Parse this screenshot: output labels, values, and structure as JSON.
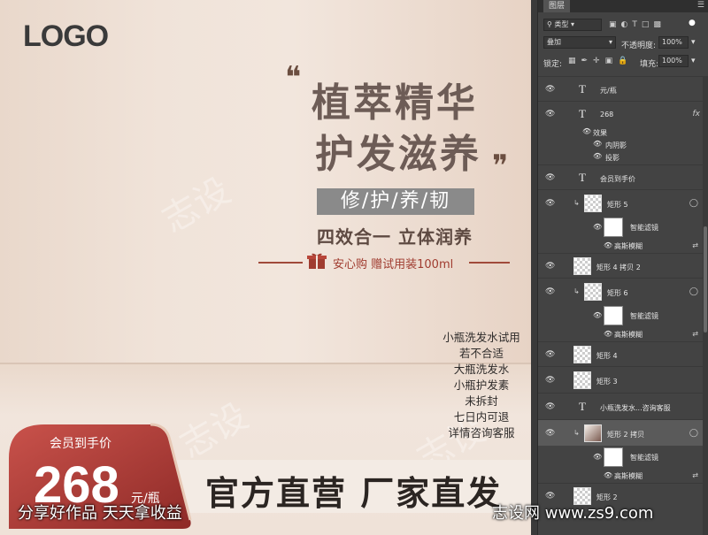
{
  "canvas": {
    "logo": "LOGO",
    "headline_1": "植萃精华",
    "headline_2": "护发滋养",
    "tag": "修/护/养/韧",
    "subline": "四效合一 立体润养",
    "gift_text": "安心购 赠试用装100ml",
    "notes": [
      "小瓶洗发水试用",
      "若不合适",
      "大瓶洗发水",
      "小瓶护发素",
      "未拆封",
      "七日内可退",
      "详情咨询客服"
    ],
    "member_label": "会员到手价",
    "price": "268",
    "price_unit": "元/瓶",
    "official": "官方直营 厂家直发",
    "watermarks": [
      "志设",
      "志设",
      "志设"
    ]
  },
  "overlay": {
    "left": "分享好作品 天天拿收益",
    "right": "志设网 www.zs9.com"
  },
  "panel": {
    "tab": "图层",
    "kind_label": "类型",
    "blend_mode": "叠加",
    "opacity_label": "不透明度:",
    "opacity_value": "100%",
    "lock_label": "锁定:",
    "fill_label": "填充:",
    "fill_value": "100%",
    "layers": [
      {
        "name": "元/瓶",
        "type": "text"
      },
      {
        "name": "268",
        "type": "text",
        "fx": "fx"
      },
      {
        "name": "效果",
        "type": "effect"
      },
      {
        "name": "内阴影",
        "type": "effect"
      },
      {
        "name": "投影",
        "type": "effect"
      },
      {
        "name": "会员到手价",
        "type": "text"
      },
      {
        "name": "矩形 5",
        "type": "shape"
      },
      {
        "name": "智能滤镜",
        "type": "filter"
      },
      {
        "name": "高斯模糊",
        "type": "filter"
      },
      {
        "name": "矩形 4 拷贝 2",
        "type": "shape"
      },
      {
        "name": "矩形 6",
        "type": "shape"
      },
      {
        "name": "智能滤镜",
        "type": "filter"
      },
      {
        "name": "高斯模糊",
        "type": "filter"
      },
      {
        "name": "矩形 4",
        "type": "shape"
      },
      {
        "name": "矩形 3",
        "type": "shape"
      },
      {
        "name": "小瓶洗发水...咨询客服",
        "type": "text"
      },
      {
        "name": "矩形 2 拷贝",
        "type": "shape"
      },
      {
        "name": "智能滤镜",
        "type": "filter"
      },
      {
        "name": "高斯模糊",
        "type": "filter"
      },
      {
        "name": "矩形 2",
        "type": "shape"
      }
    ]
  },
  "colors": {
    "accent_red": "#b53a36",
    "panel_bg": "#434343",
    "text_brown": "#6d5c56"
  }
}
